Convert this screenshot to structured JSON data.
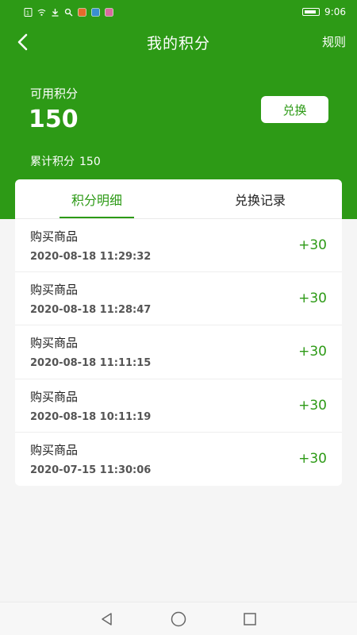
{
  "status_bar": {
    "time": "9:06",
    "icons": [
      "sim-icon",
      "wifi-icon",
      "download-icon",
      "search-icon",
      "app-notification-icon",
      "app-notification-icon",
      "app-notification-icon",
      "battery-icon"
    ]
  },
  "header": {
    "title": "我的积分",
    "rules_label": "规则",
    "back_icon": "back-arrow-icon"
  },
  "points": {
    "available_label": "可用积分",
    "available_value": "150",
    "redeem_label": "兑换",
    "cumulative_label": "累计积分",
    "cumulative_value": "150"
  },
  "tabs": [
    {
      "label": "积分明细",
      "active": true
    },
    {
      "label": "兑换记录",
      "active": false
    }
  ],
  "records": [
    {
      "name": "购买商品",
      "time": "2020-08-18 11:29:32",
      "delta": "+30"
    },
    {
      "name": "购买商品",
      "time": "2020-08-18 11:28:47",
      "delta": "+30"
    },
    {
      "name": "购买商品",
      "time": "2020-08-18 11:11:15",
      "delta": "+30"
    },
    {
      "name": "购买商品",
      "time": "2020-08-18 10:11:19",
      "delta": "+30"
    },
    {
      "name": "购买商品",
      "time": "2020-07-15 11:30:06",
      "delta": "+30"
    }
  ],
  "system_nav": [
    "back-triangle-icon",
    "home-circle-icon",
    "recents-square-icon"
  ],
  "colors": {
    "brand_green": "#2d9a16",
    "background": "#f5f5f5",
    "card": "#ffffff"
  }
}
